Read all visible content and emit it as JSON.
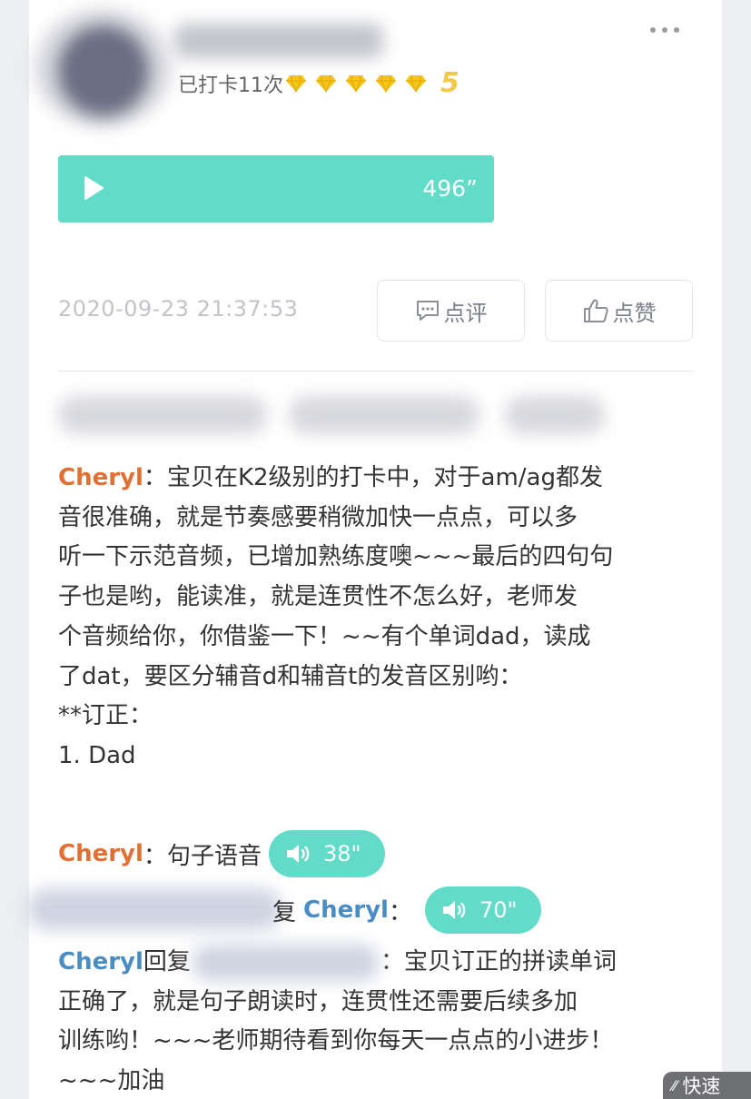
{
  "post": {
    "checkin_text": "已打卡11次",
    "level": "5",
    "diamond_count": 5,
    "accent_color": "#62dbc8",
    "diamond_color": "#f5c518"
  },
  "audio": {
    "duration": "496”",
    "icon": "play-icon"
  },
  "meta": {
    "timestamp": "2020-09-23 21:37:53",
    "comment_label": "点评",
    "like_label": "点赞"
  },
  "comments": [
    {
      "author": "Cheryl",
      "separator": "：",
      "lines": [
        "宝贝在K2级别的打卡中，对于am/ag都发",
        "音很准确，就是节奏感要稍微加快一点点，可以多",
        "听一下示范音频，已增加熟练度噢~~~最后的四句句",
        "子也是哟，能读准，就是连贯性不怎么好，老师发",
        "个音频给你，你借鉴一下！~~有个单词dad，读成",
        "了dat，要区分辅音d和辅音t的发音区别哟：",
        "**订正：",
        "1. Dad"
      ]
    },
    {
      "author": "Cheryl",
      "separator": "：",
      "text": "句子语音",
      "voice_duration": "38\""
    },
    {
      "prefix": "复",
      "author": "Cheryl",
      "separator": "：",
      "voice_duration": "70\""
    },
    {
      "author": "Cheryl",
      "reply_word": "回复",
      "separator": "：",
      "lines": [
        "宝贝订正的拼读单词",
        "正确了，就是句子朗读时，连贯性还需要后续多加",
        "训练哟！~~~老师期待看到你每天一点点的小进步！",
        "~~~加油"
      ]
    }
  ],
  "overlay": {
    "quick_read": "快速"
  }
}
